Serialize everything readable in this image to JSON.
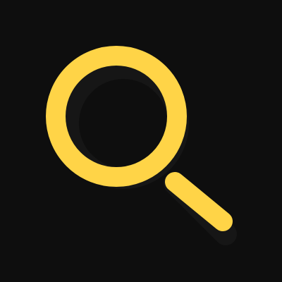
{
  "icon": {
    "name": "search-icon",
    "description_label": ""
  },
  "colors": {
    "background": "#0e0e0e",
    "accent": "#ffd447",
    "shadow": "#161616"
  }
}
